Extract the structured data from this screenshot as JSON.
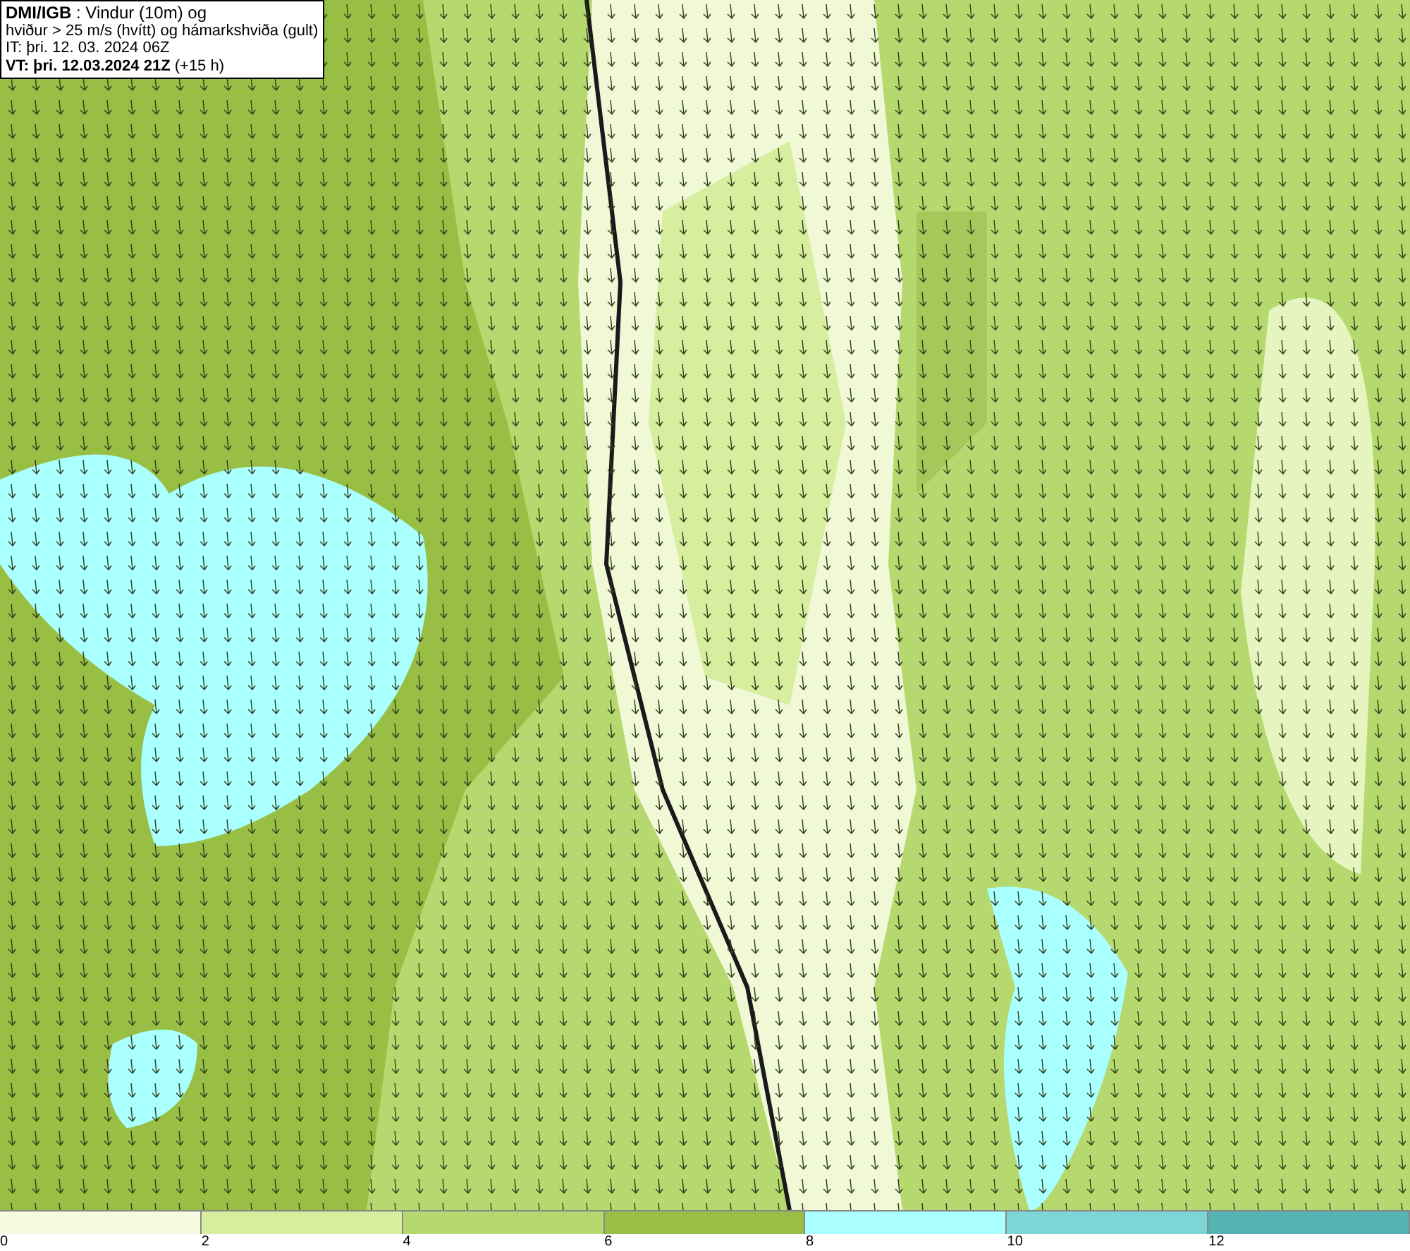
{
  "title_box": {
    "lines": [
      "**DMI/IGB** : Vindur (10m) og",
      "hviður > 25 m/s (hvítt) og hámarkshviða (gult)",
      "IT: þri. 12. 03. 2024 06Z",
      "**VT: þri. 12.03.2024 21Z** (+15 h)"
    ]
  },
  "legend": [
    {
      "label": "0",
      "color": "#f5fbe0"
    },
    {
      "label": "2",
      "color": "#d6ee9e"
    },
    {
      "label": "4",
      "color": "#b5d96f"
    },
    {
      "label": "6",
      "color": "#98bf44"
    },
    {
      "label": "8",
      "color": "#aaffff"
    },
    {
      "label": "10",
      "color": "#7dd6d6"
    },
    {
      "label": "12",
      "color": "#55b3b3"
    }
  ]
}
